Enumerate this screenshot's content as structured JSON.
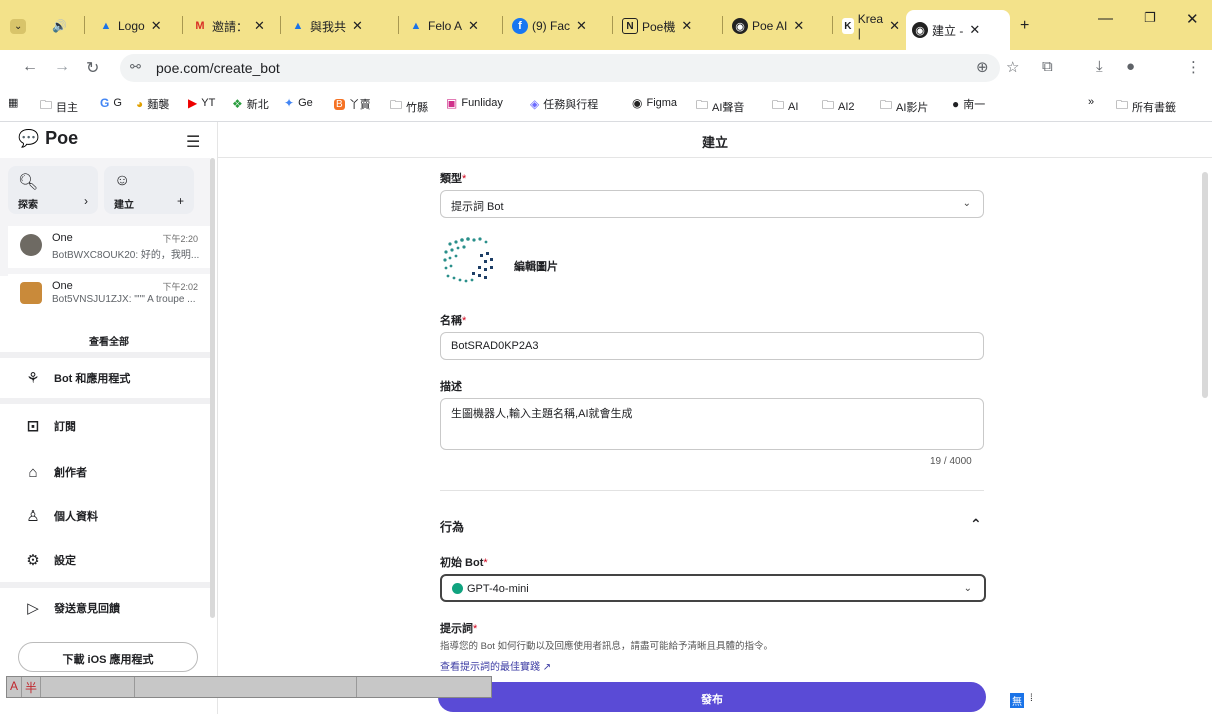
{
  "browser": {
    "tabs": [
      {
        "label": "Logo",
        "icon": "drive-icon"
      },
      {
        "label": "邀請：",
        "icon": "gmail-icon"
      },
      {
        "label": "與我共",
        "icon": "drive-icon"
      },
      {
        "label": "Felo A",
        "icon": "drive-icon"
      },
      {
        "label": "(9) Fac",
        "icon": "facebook-icon"
      },
      {
        "label": "Poe機",
        "icon": "notion-icon"
      },
      {
        "label": "Poe AI",
        "icon": "poe-icon"
      },
      {
        "label": "Krea |",
        "icon": "krea-icon"
      },
      {
        "label": "建立 -",
        "icon": "poe-icon"
      }
    ],
    "url": "poe.com/create_bot",
    "bookmarks": [
      "目主",
      "G",
      "麵襲",
      "YT",
      "新北",
      "Ge",
      "丫賣",
      "竹縣",
      "Funliday",
      "任務與行程",
      "Figma",
      "AI聲音",
      "AI",
      "AI2",
      "AI影片",
      "南一"
    ],
    "all_bookmarks": "所有書籤"
  },
  "sidebar": {
    "brand": "Poe",
    "explore_label": "探索",
    "create_label": "建立",
    "chats": [
      {
        "name": "One",
        "time": "下午2:20",
        "preview": "BotBWXC8OUK20: 好的，我明..."
      },
      {
        "name": "One",
        "time": "下午2:02",
        "preview": "Bot5VNSJU1ZJX: \"\"\" A troupe ..."
      }
    ],
    "view_all": "查看全部",
    "nav": [
      {
        "label": "Bot 和應用程式",
        "icon": "apps-icon"
      },
      {
        "label": "訂閱",
        "icon": "subscribe-icon"
      },
      {
        "label": "創作者",
        "icon": "creators-icon"
      },
      {
        "label": "個人資料",
        "icon": "profile-icon"
      },
      {
        "label": "設定",
        "icon": "settings-icon"
      },
      {
        "label": "發送意見回饋",
        "icon": "send-icon"
      }
    ],
    "ios_button": "下載 iOS 應用程式"
  },
  "main": {
    "title": "建立",
    "type_label": "類型",
    "type_value": "提示詞 Bot",
    "edit_image": "編輯圖片",
    "name_label": "名稱",
    "name_value": "BotSRAD0KP2A3",
    "desc_label": "描述",
    "desc_value": "生圖機器人,輸入主題名稱,AI就會生成",
    "char_count": "19 / 4000",
    "behavior_label": "行為",
    "base_bot_label": "初始 Bot",
    "base_bot_value": "GPT-4o-mini",
    "prompt_label": "提示詞",
    "prompt_help": "指導您的 Bot 如何行動以及回應使用者訊息，請盡可能給予清晰且具體的指令。",
    "prompt_link": "查看提示詞的最佳實踐",
    "publish": "發布",
    "required_mark": "*"
  },
  "ime": {
    "mode": "A",
    "width": "半"
  },
  "colors": {
    "accent": "#5a4bd6",
    "tabstrip": "#f3e28a",
    "required": "#d0021b"
  }
}
